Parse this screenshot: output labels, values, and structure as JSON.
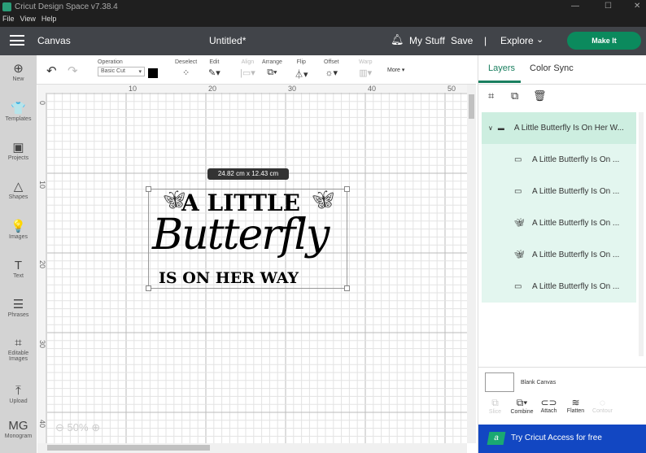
{
  "window": {
    "title": "Cricut Design Space  v7.38.4",
    "minimize": "—",
    "maximize": "☐",
    "close": "✕"
  },
  "menu": [
    "File",
    "View",
    "Help"
  ],
  "header": {
    "section": "Canvas",
    "doc_title": "Untitled*",
    "my_stuff": "My Stuff",
    "save": "Save",
    "separator": "|",
    "explore": "Explore",
    "make_it": "Make It"
  },
  "sidebar": [
    {
      "label": "New",
      "icon": "⊕"
    },
    {
      "label": "Templates",
      "icon": "👕"
    },
    {
      "label": "Projects",
      "icon": "▣"
    },
    {
      "label": "Shapes",
      "icon": "△"
    },
    {
      "label": "Images",
      "icon": "💡"
    },
    {
      "label": "Text",
      "icon": "T"
    },
    {
      "label": "Phrases",
      "icon": "☰"
    },
    {
      "label": "Editable Images",
      "icon": "⌗"
    },
    {
      "label": "Upload",
      "icon": "⤒"
    },
    {
      "label": "Monogram",
      "icon": "MG"
    }
  ],
  "toolbar": {
    "operation_label": "Operation",
    "operation_value": "Basic Cut",
    "deselect": "Deselect",
    "edit": "Edit",
    "align": "Align",
    "arrange": "Arrange",
    "flip": "Flip",
    "offset": "Offset",
    "warp": "Warp",
    "more": "More ▾",
    "color": "#000000"
  },
  "canvas": {
    "x_ticks": [
      "10",
      "20",
      "30",
      "40",
      "50"
    ],
    "y_ticks": [
      "0",
      "10",
      "20",
      "30",
      "40"
    ],
    "size_label": "24.82  cm x 12.43  cm",
    "design": {
      "line1": "A LITTLE",
      "line2": "Butterfly",
      "line3": "IS ON HER WAY"
    },
    "zoom": "50%"
  },
  "panel": {
    "tabs": [
      "Layers",
      "Color Sync"
    ],
    "group": "A Little Butterfly Is On Her W...",
    "children": [
      "A Little Butterfly Is On ...",
      "A Little Butterfly Is On ...",
      "A Little Butterfly Is On ...",
      "A Little Butterfly Is On ...",
      "A Little Butterfly Is On ..."
    ],
    "blank_canvas": "Blank Canvas",
    "actions": [
      "Slice",
      "Combine",
      "Attach",
      "Flatten",
      "Contour"
    ],
    "access": "Try Cricut Access for free",
    "access_logo": "a"
  },
  "colors": {
    "accent": "#1a7f5f",
    "make_it": "#0b8a5d",
    "access_bg": "#1247c2"
  }
}
